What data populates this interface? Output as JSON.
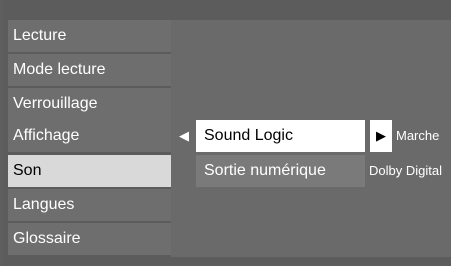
{
  "menu": {
    "items": [
      {
        "label": "Lecture"
      },
      {
        "label": "Mode lecture"
      },
      {
        "label": "Verrouillage"
      },
      {
        "label": "Affichage"
      },
      {
        "label": "Son"
      },
      {
        "label": "Langues"
      },
      {
        "label": "Glossaire"
      }
    ],
    "selected": "Son"
  },
  "submenu": {
    "options": [
      {
        "label": "Sound Logic",
        "value": "Marche"
      },
      {
        "label": "Sortie numérique",
        "value": "Dolby Digital"
      }
    ],
    "left_arrow_icon": "triangle-left-icon",
    "right_arrow_icon": "triangle-right-icon"
  },
  "colors": {
    "background": "#5e5e5e",
    "item_bg": "#6e6e6e",
    "selected_bg": "#d9d9d9",
    "active_option_bg": "#ffffff"
  }
}
